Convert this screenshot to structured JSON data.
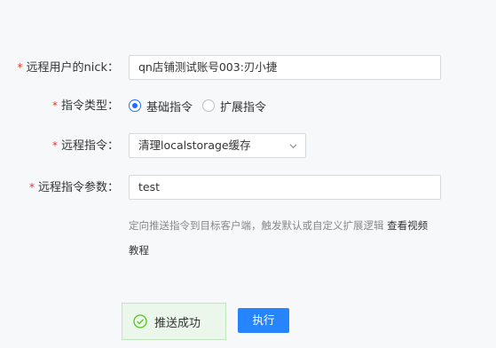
{
  "form": {
    "nick": {
      "label": "远程用户的nick：",
      "value": "qn店铺测试账号003:刃小捷"
    },
    "command_type": {
      "label": "指令类型：",
      "options": [
        "基础指令",
        "扩展指令"
      ],
      "selected": "基础指令"
    },
    "command": {
      "label": "远程指令：",
      "value": "清理localstorage缓存"
    },
    "params": {
      "label": "远程指令参数：",
      "value": "test"
    },
    "required_mark": "*",
    "hint": {
      "text": "定向推送指令到目标客户端，触发默认或自定义扩展逻辑 ",
      "link_line1": "查看视频",
      "link_line2": "教程"
    }
  },
  "toast": {
    "text": "推送成功",
    "icon": "check-circle-icon"
  },
  "actions": {
    "execute_label": "执行"
  },
  "colors": {
    "required": "#e5352b",
    "accent": "#1e6fff",
    "button": "#2684ff",
    "toast_bg": "#ebf7ea",
    "toast_icon": "#52c41a"
  }
}
